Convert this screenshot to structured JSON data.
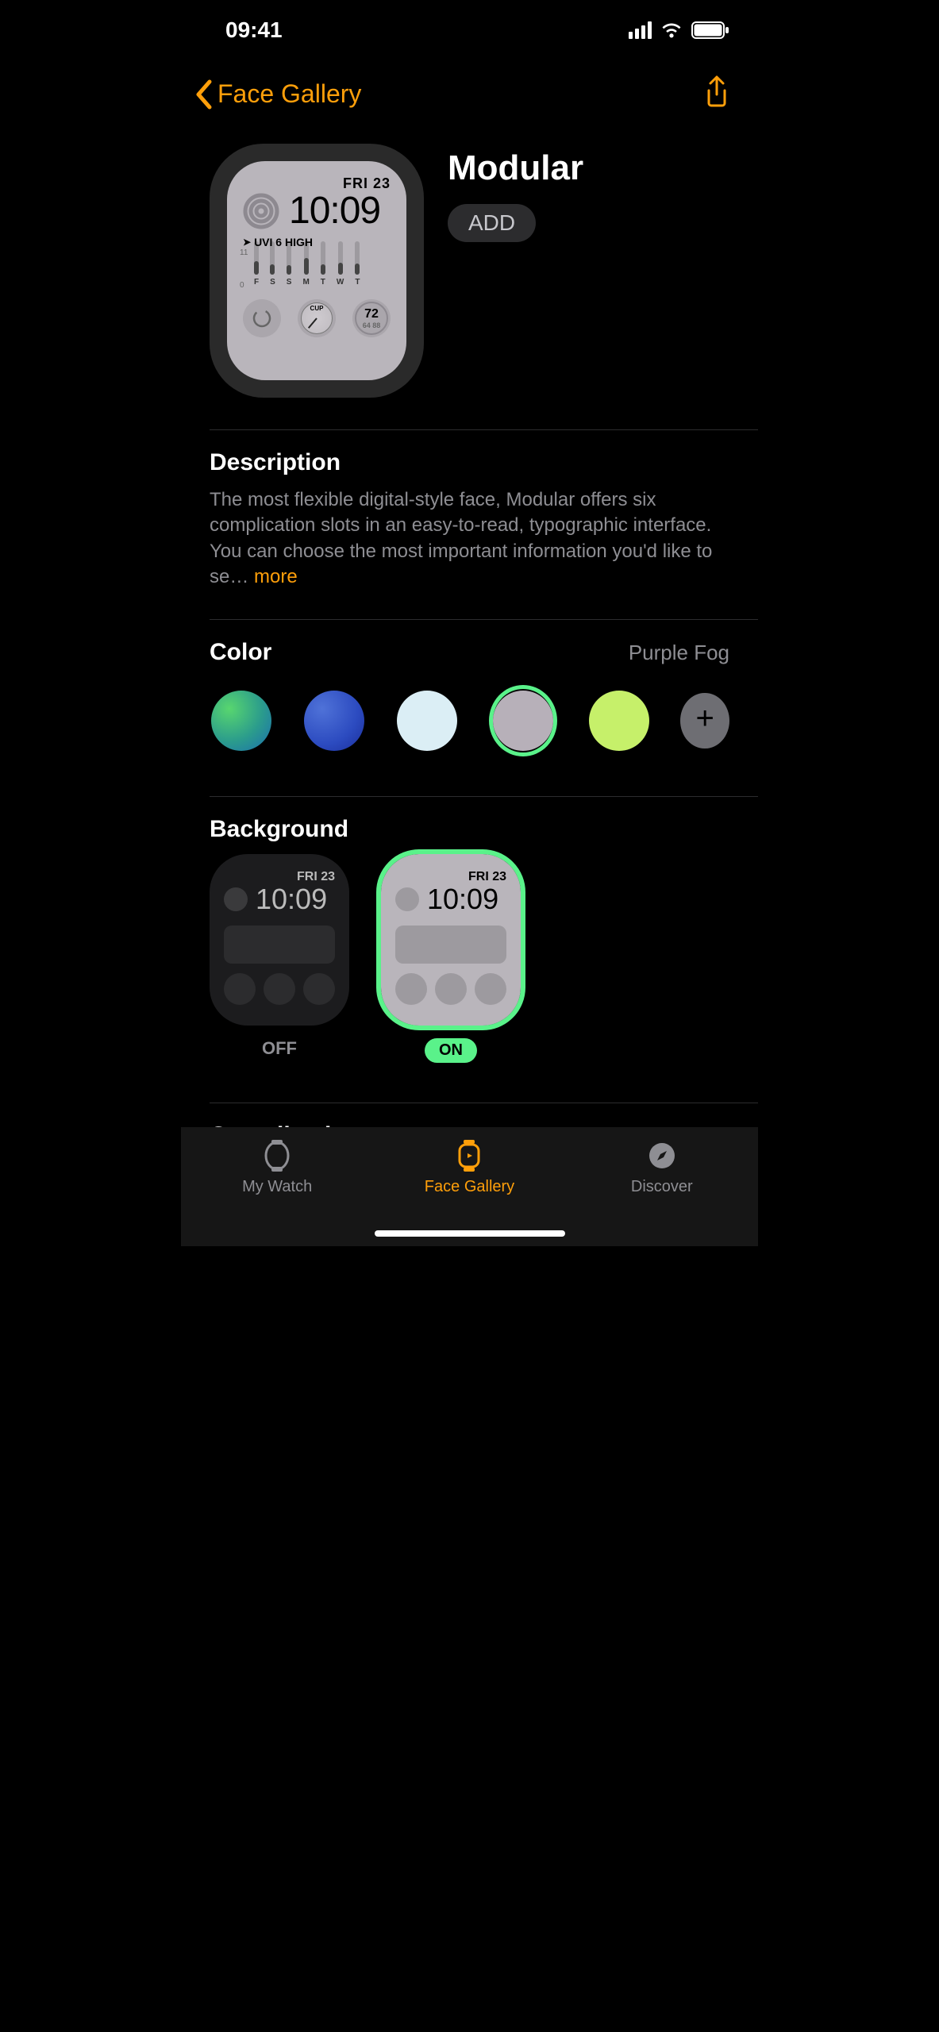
{
  "status": {
    "time": "09:41"
  },
  "nav": {
    "back_label": "Face Gallery"
  },
  "face": {
    "title": "Modular",
    "add_label": "ADD",
    "preview": {
      "date": "FRI 23",
      "time": "10:09",
      "uvi_line": "UVI 6 HIGH",
      "axis_top": "11",
      "axis_bottom": "0",
      "days": [
        "F",
        "S",
        "S",
        "M",
        "T",
        "W",
        "T"
      ],
      "bar_heights_pct": [
        40,
        30,
        28,
        50,
        32,
        36,
        34
      ],
      "cup_label": "CUP",
      "temp_current": "72",
      "temp_low_high": "64 88"
    }
  },
  "description": {
    "heading": "Description",
    "text": "The most flexible digital-style face, Modular offers six complication slots in an easy-to-read, typographic interface. You can choose the most important information you'd like to se…",
    "more": "more"
  },
  "color": {
    "heading": "Color",
    "selected_name": "Purple Fog",
    "swatches": [
      {
        "id": "green-gradient",
        "css": "sw-green",
        "selected": false
      },
      {
        "id": "blue",
        "css": "sw-blue",
        "selected": false
      },
      {
        "id": "light-blue",
        "css": "sw-light",
        "selected": false
      },
      {
        "id": "purple-fog",
        "css": "sw-purple",
        "selected": true
      },
      {
        "id": "lime",
        "css": "sw-lime",
        "selected": false
      }
    ]
  },
  "background": {
    "heading": "Background",
    "options": [
      {
        "id": "off",
        "label": "OFF",
        "selected": false
      },
      {
        "id": "on",
        "label": "ON",
        "selected": true
      }
    ],
    "preview_date": "FRI 23",
    "preview_time": "10:09"
  },
  "complications": {
    "heading": "Complications"
  },
  "tabs": {
    "my_watch": "My Watch",
    "face_gallery": "Face Gallery",
    "discover": "Discover"
  },
  "accent": {
    "orange": "#ff9f0a",
    "selection_green": "#5af28a",
    "purple_fog": "#b7b0b9"
  }
}
